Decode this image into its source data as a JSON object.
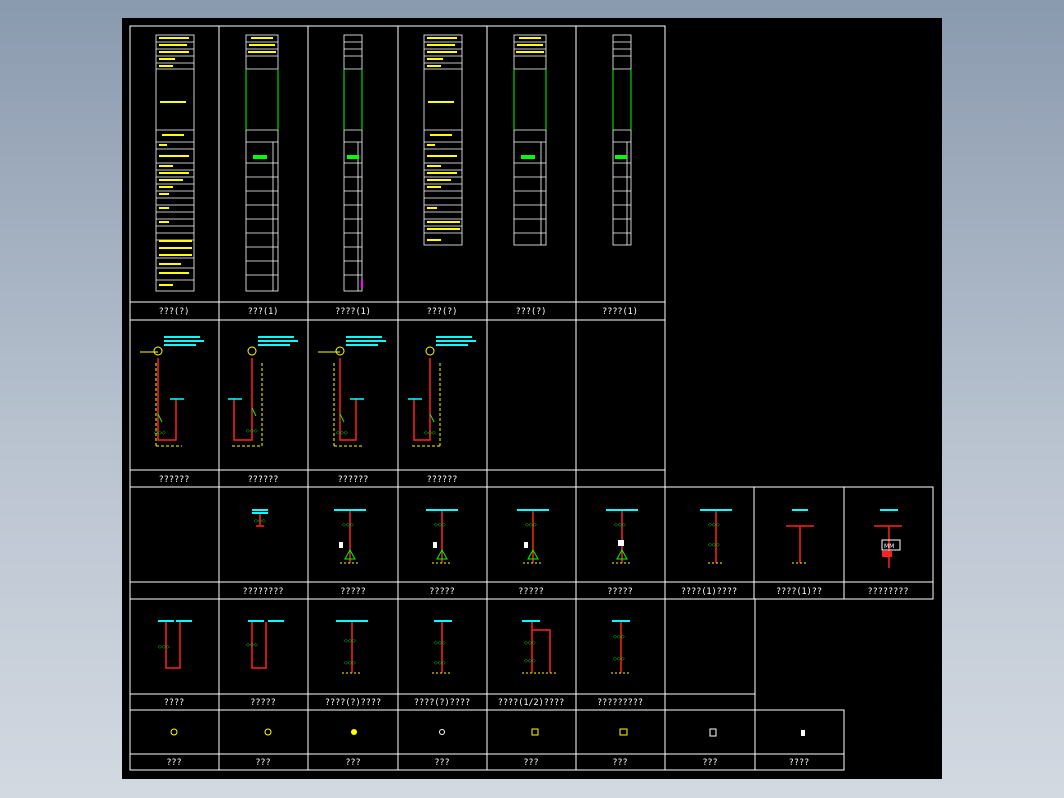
{
  "colors": {
    "background": "#000000",
    "frame": "#ffffff",
    "busbar": "#00ffff",
    "conductor": "#ff2020",
    "component": "#ffff00",
    "switch": "#00ff00",
    "accent": "#ff00ff"
  },
  "row1_labels": [
    "???(?)",
    "???(1)",
    "????(1)",
    "???(?)",
    "???(?)",
    "????(1)"
  ],
  "row2_labels": [
    "??????",
    "??????",
    "??????",
    "??????",
    "",
    ""
  ],
  "row3_labels": [
    "",
    "????????",
    "?????",
    "?????",
    "?????",
    "?????",
    "????(1)????",
    "????(1)??",
    "????????"
  ],
  "row4_labels": [
    "????",
    "?????",
    "????(?)????",
    "????(?)????",
    "????(1/2)????",
    "?????????",
    ""
  ],
  "row5_labels": [
    "???",
    "???",
    "???",
    "???",
    "???",
    "???",
    "???",
    "????"
  ]
}
